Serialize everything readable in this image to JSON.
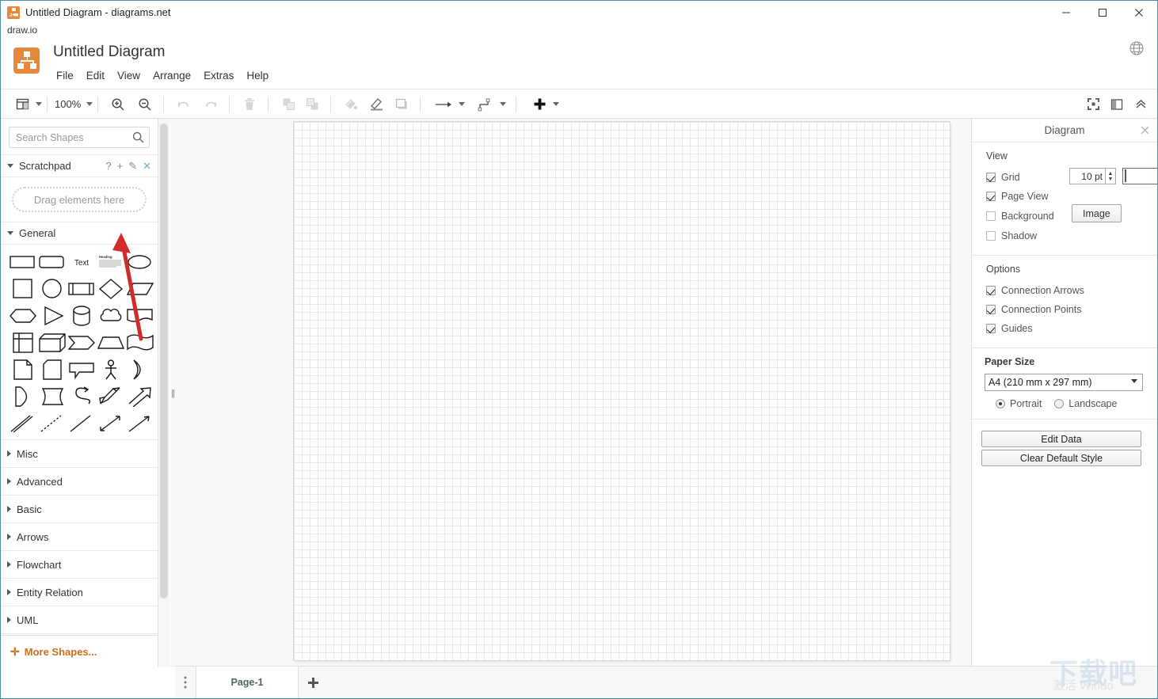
{
  "window": {
    "title": "Untitled Diagram - diagrams.net",
    "app_icon": "drawio-app-icon",
    "minimize_label": "–",
    "maximize_label": "□",
    "close_label": "✕"
  },
  "subtitle": "draw.io",
  "header": {
    "doc_title": "Untitled Diagram",
    "logo": "drawio-logo",
    "menus": [
      "File",
      "Edit",
      "View",
      "Arrange",
      "Extras",
      "Help"
    ],
    "language_icon": "globe-icon"
  },
  "toolbar": {
    "view_icon": "layout-view-icon",
    "zoom_level": "100%",
    "zoom_in_icon": "zoom-in-icon",
    "zoom_out_icon": "zoom-out-icon",
    "undo_icon": "undo-icon",
    "redo_icon": "redo-icon",
    "delete_icon": "trash-icon",
    "to_front_icon": "bring-to-front-icon",
    "to_back_icon": "send-to-back-icon",
    "fill_color_icon": "fill-color-icon",
    "line_color_icon": "line-color-icon",
    "shadow_icon": "shadow-icon",
    "waypoints_icon": "arrow-style-icon",
    "connection_icon": "connection-style-icon",
    "insert_icon": "plus-insert-icon",
    "fullscreen_icon": "fullscreen-icon",
    "format_panel_icon": "format-panel-icon",
    "collapse_icon": "chevron-up-icon"
  },
  "shapes_panel": {
    "search": {
      "placeholder": "Search Shapes",
      "value": "",
      "icon": "search-icon"
    },
    "scratchpad": {
      "label": "Scratchpad",
      "help_icon": "?",
      "add_icon": "+",
      "edit_icon": "✎",
      "close_icon": "✕",
      "dropzone_text": "Drag elements here"
    },
    "general": {
      "label": "General",
      "shapes": [
        "rectangle",
        "rounded-rectangle",
        "text",
        "textbox",
        "ellipse",
        "square",
        "circle",
        "process",
        "diamond",
        "parallelogram",
        "hexagon",
        "triangle",
        "cylinder",
        "cloud",
        "document",
        "internal-storage",
        "cube",
        "step",
        "trapezoid",
        "tape",
        "note",
        "card",
        "callout",
        "actor",
        "or",
        "and",
        "data-storage",
        "curve",
        "bidirectional-arrow",
        "arrow",
        "double-line",
        "dashed-line",
        "line",
        "bidirectional-connector",
        "directional-connector"
      ]
    },
    "categories": [
      "Misc",
      "Advanced",
      "Basic",
      "Arrows",
      "Flowchart",
      "Entity Relation",
      "UML"
    ],
    "more_shapes": "More Shapes..."
  },
  "format_panel": {
    "title": "Diagram",
    "close_icon": "close-icon",
    "view": {
      "heading": "View",
      "grid": {
        "label": "Grid",
        "checked": true,
        "size": "10 pt",
        "color": "#cfcfcf"
      },
      "page_view": {
        "label": "Page View",
        "checked": true
      },
      "background": {
        "label": "Background",
        "checked": false,
        "button": "Image"
      },
      "shadow": {
        "label": "Shadow",
        "checked": false
      }
    },
    "options": {
      "heading": "Options",
      "items": [
        {
          "label": "Connection Arrows",
          "checked": true
        },
        {
          "label": "Connection Points",
          "checked": true
        },
        {
          "label": "Guides",
          "checked": true
        }
      ]
    },
    "paper": {
      "heading": "Paper Size",
      "selected": "A4 (210 mm x 297 mm)",
      "orientation": [
        {
          "label": "Portrait",
          "selected": true
        },
        {
          "label": "Landscape",
          "selected": false
        }
      ]
    },
    "actions": [
      "Edit Data",
      "Clear Default Style"
    ]
  },
  "page_bar": {
    "menu_icon": "page-menu-icon",
    "tabs": [
      {
        "label": "Page-1",
        "active": true
      }
    ],
    "add_label": "+"
  },
  "watermark": {
    "main": "下载吧",
    "sub": "激活 Windo"
  },
  "annotation": {
    "type": "red-arrow",
    "color": "#d22b2b"
  }
}
